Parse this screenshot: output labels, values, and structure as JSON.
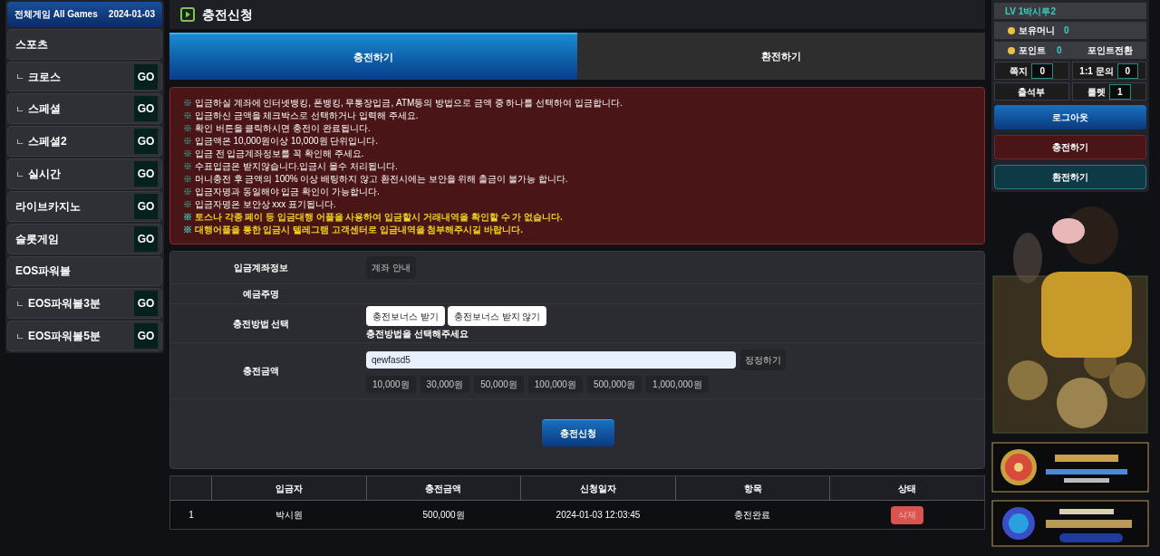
{
  "sidebar": {
    "title": "전체게임 All Games",
    "date": "2024-01-03",
    "items": [
      {
        "label": "스포츠"
      },
      {
        "mark": "ㄴ",
        "label": "크로스",
        "go": "GO"
      },
      {
        "mark": "ㄴ",
        "label": "스페셜",
        "go": "GO"
      },
      {
        "mark": "ㄴ",
        "label": "스페셜2",
        "go": "GO"
      },
      {
        "mark": "ㄴ",
        "label": "실시간",
        "go": "GO"
      },
      {
        "label": "라이브카지노",
        "go": "GO"
      },
      {
        "label": "슬롯게임",
        "go": "GO"
      },
      {
        "label": "EOS파워볼"
      },
      {
        "mark": "ㄴ",
        "label": "EOS파워볼3분",
        "go": "GO"
      },
      {
        "mark": "ㄴ",
        "label": "EOS파워볼5분",
        "go": "GO"
      }
    ]
  },
  "page_title": "충전신청",
  "tabs": [
    {
      "label": "충전하기",
      "selected": true
    },
    {
      "label": "환전하기",
      "selected": false
    }
  ],
  "notices": {
    "mark": "※",
    "lines": [
      {
        "text": "입금하실 계좌에 인터넷뱅킹, 폰뱅킹, 무통장입금, ATM등의 방법으로 금액 중 하나를 선택하여 입금합니다.",
        "highlight": false
      },
      {
        "text": "입금하신 금액을 체크박스로 선택하거나 입력해 주세요.",
        "highlight": false
      },
      {
        "text": "확인 버튼을 클릭하시면 충전이 완료됩니다.",
        "highlight": false
      },
      {
        "text": "입금액은 10,000원이상 10,000원 단위입니다.",
        "highlight": false
      },
      {
        "text": "입금 전 입금계좌정보를 꼭 확인해 주세요.",
        "highlight": false
      },
      {
        "text": "수표입금은 받지않습니다.입금시 몰수 처리됩니다.",
        "highlight": false
      },
      {
        "text": "머니충전 후 금액의 100% 이상 배팅하지 않고 환전시에는 보안을 위해 출금이 불가능 합니다.",
        "highlight": false
      },
      {
        "text": "입금자명과 동일해야 입금 확인이 가능합니다.",
        "highlight": false
      },
      {
        "text": "입금자명은 보안상 xxx 표기됩니다.",
        "highlight": false
      },
      {
        "text": "토스나 각종 페이 등 입금대행 어플을 사용하여 입금할시 거래내역을 확인할 수 가 없습니다.",
        "highlight": true
      },
      {
        "text": "대행어플을 통한 입금시 텔레그램 고객센터로 입금내역을 첨부해주시길 바랍니다.",
        "highlight": true
      }
    ]
  },
  "form": {
    "account_label": "입금계좌정보",
    "account_button": "계좌 안내",
    "holder_label": "예금주명",
    "method_label": "충전방법 선택",
    "methods": [
      "충전보너스 받기",
      "충전보너스 받지 않기"
    ],
    "method_hint": "충전방법을 선택해주세요",
    "amount_label": "충전금액",
    "amount_value": "qewfasd5",
    "reset_button": "정정하기",
    "amounts": [
      "10,000원",
      "30,000원",
      "50,000원",
      "100,000원",
      "500,000원",
      "1,000,000원"
    ],
    "submit": "충전신청"
  },
  "table": {
    "columns": [
      "입금자",
      "충전금액",
      "신청일자",
      "항목",
      "상태"
    ],
    "rows": [
      {
        "no": "1",
        "name": "박시원",
        "amount": "500,000원",
        "date": "2024-01-03 12:03:45",
        "item": "충전완료",
        "action": "삭제"
      }
    ]
  },
  "account": {
    "level": "LV 1박시루2",
    "money_label": "보유머니",
    "money": "0",
    "point_label": "포인트",
    "point": "0",
    "point_convert": "포인트전환",
    "memo_label": "쪽지",
    "memo": "0",
    "inquiry_label": "1:1 문의",
    "inquiry": "0",
    "attendance": "출석부",
    "roulette_label": "룰렛",
    "roulette": "1",
    "logout": "로그아웃",
    "deposit": "충전하기",
    "withdraw": "환전하기"
  }
}
